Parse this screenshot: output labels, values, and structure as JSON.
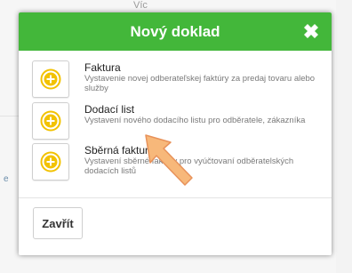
{
  "background": {
    "more_label": "Víc",
    "left_fragment": "e"
  },
  "modal": {
    "title": "Nový doklad",
    "close_icon": "close-x-icon",
    "options": [
      {
        "title": "Faktura",
        "description": "Vystavenie novej odberateľskej faktúry za predaj tovaru alebo služby",
        "icon": "plus-circle-icon"
      },
      {
        "title": "Dodací list",
        "description": "Vystavení nového dodacího listu pro odběratele, zákazníka",
        "icon": "plus-circle-icon"
      },
      {
        "title": "Sběrná faktura",
        "description": "Vystavení sběrné faktury pro vyúčtovaní odběratelských dodacích listů",
        "icon": "plus-circle-icon"
      }
    ],
    "footer": {
      "close_label": "Zavřít"
    }
  },
  "colors": {
    "header": "#43b73a",
    "plus_icon": "#f2c200",
    "arrow": "#f7b87a"
  }
}
